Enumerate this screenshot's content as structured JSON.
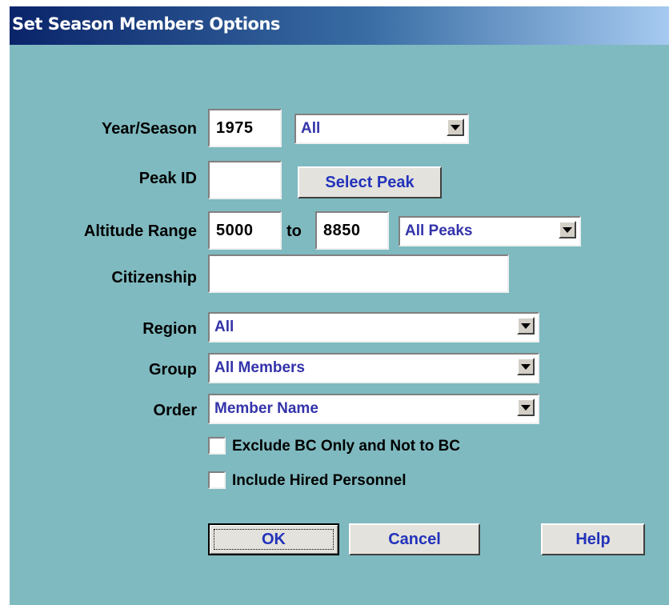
{
  "dialog": {
    "title": "Set Season Members Options"
  },
  "year_season": {
    "label": "Year/Season",
    "year_value": "1975",
    "season_value": "All"
  },
  "peak": {
    "label": "Peak ID",
    "value": "",
    "select_button": "Select Peak"
  },
  "altitude": {
    "label": "Altitude Range",
    "from_value": "5000",
    "to_label": "to",
    "to_value": "8850",
    "scope_value": "All Peaks"
  },
  "citizenship": {
    "label": "Citizenship",
    "value": ""
  },
  "region": {
    "label": "Region",
    "value": "All"
  },
  "group": {
    "label": "Group",
    "value": "All Members"
  },
  "order": {
    "label": "Order",
    "value": "Member Name"
  },
  "options": {
    "exclude_bc": {
      "label": "Exclude BC Only and Not to BC",
      "checked": false
    },
    "include_hired": {
      "label": "Include Hired Personnel",
      "checked": false
    }
  },
  "buttons": {
    "ok": "OK",
    "cancel": "Cancel",
    "help": "Help"
  },
  "colors": {
    "dialog_bg": "#7fbac0",
    "combo_text": "#3333aa",
    "button_text": "#2233bb"
  },
  "icons": {
    "dropdown": "chevron-down-icon"
  }
}
